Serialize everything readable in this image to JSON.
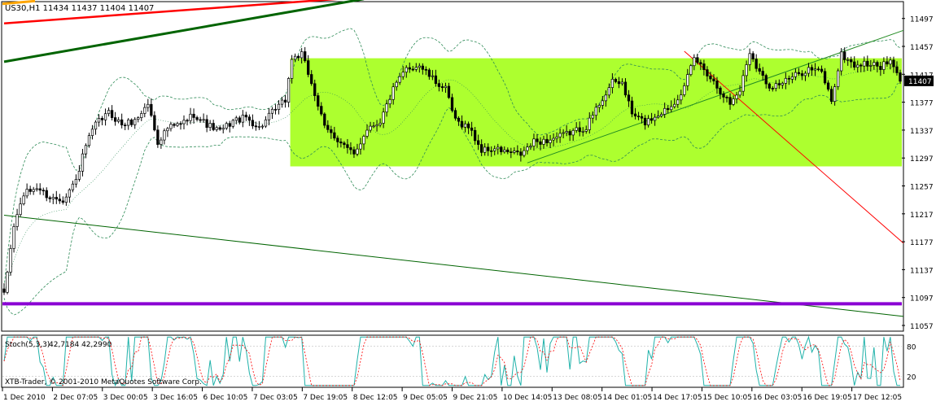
{
  "window": {
    "symbol_label": "US30,H1  11434 11437 11404 11407",
    "watermark": "XTB-Trader, © 2001-2010 MetaQuotes Software Corp."
  },
  "colors": {
    "bull_candle": "#000000",
    "bear_candle": "#000000",
    "range_box": "#adff2f",
    "bollinger": "#2e8b57",
    "trend_up": "#228b22",
    "trend_red": "#ff0000",
    "trend_down": "#006400",
    "support_purple": "#8a00d4",
    "stoch_main": "#20b2aa",
    "stoch_signal": "#ff0000",
    "price_tag_bg": "#000000",
    "price_tag_text": "#ffffff"
  },
  "chart_data": [
    {
      "type": "candlestick",
      "title": "US30,H1",
      "last_price": 11407,
      "ohlc_header": {
        "open": 11434,
        "high": 11437,
        "low": 11404,
        "close": 11407
      },
      "ylim": [
        11050,
        11520
      ],
      "y_ticks": [
        "11497",
        "11457",
        "11417",
        "11377",
        "11337",
        "11297",
        "11257",
        "11217",
        "11177",
        "11137",
        "11097",
        "11057"
      ],
      "x_ticks": [
        "1 Dec 2010",
        "2 Dec 07:05",
        "3 Dec 00:05",
        "3 Dec 16:05",
        "6 Dec 10:05",
        "7 Dec 03:05",
        "7 Dec 19:05",
        "8 Dec 12:05",
        "9 Dec 05:05",
        "9 Dec 21:05",
        "10 Dec 14:05",
        "13 Dec 08:05",
        "14 Dec 01:05",
        "14 Dec 17:05",
        "15 Dec 10:05",
        "16 Dec 03:05",
        "16 Dec 19:05",
        "17 Dec 12:05"
      ],
      "bar_count": 275,
      "anchors": [
        [
          0,
          11100
        ],
        [
          3,
          11200
        ],
        [
          6,
          11245
        ],
        [
          10,
          11255
        ],
        [
          14,
          11240
        ],
        [
          18,
          11238
        ],
        [
          22,
          11265
        ],
        [
          25,
          11315
        ],
        [
          28,
          11345
        ],
        [
          32,
          11362
        ],
        [
          36,
          11345
        ],
        [
          40,
          11350
        ],
        [
          44,
          11375
        ],
        [
          47,
          11320
        ],
        [
          50,
          11340
        ],
        [
          54,
          11345
        ],
        [
          58,
          11360
        ],
        [
          62,
          11345
        ],
        [
          66,
          11335
        ],
        [
          70,
          11350
        ],
        [
          74,
          11355
        ],
        [
          78,
          11340
        ],
        [
          82,
          11362
        ],
        [
          86,
          11380
        ],
        [
          88,
          11440
        ],
        [
          91,
          11445
        ],
        [
          94,
          11405
        ],
        [
          98,
          11340
        ],
        [
          103,
          11320
        ],
        [
          107,
          11300
        ],
        [
          111,
          11340
        ],
        [
          115,
          11350
        ],
        [
          119,
          11395
        ],
        [
          123,
          11425
        ],
        [
          127,
          11430
        ],
        [
          131,
          11410
        ],
        [
          135,
          11395
        ],
        [
          138,
          11350
        ],
        [
          142,
          11342
        ],
        [
          146,
          11308
        ],
        [
          150,
          11310
        ],
        [
          154,
          11305
        ],
        [
          158,
          11302
        ],
        [
          162,
          11320
        ],
        [
          166,
          11322
        ],
        [
          170,
          11328
        ],
        [
          174,
          11335
        ],
        [
          178,
          11342
        ],
        [
          182,
          11375
        ],
        [
          186,
          11405
        ],
        [
          189,
          11405
        ],
        [
          192,
          11360
        ],
        [
          196,
          11348
        ],
        [
          200,
          11360
        ],
        [
          204,
          11372
        ],
        [
          208,
          11398
        ],
        [
          211,
          11440
        ],
        [
          214,
          11425
        ],
        [
          218,
          11400
        ],
        [
          222,
          11375
        ],
        [
          225,
          11395
        ],
        [
          228,
          11450
        ],
        [
          231,
          11420
        ],
        [
          234,
          11400
        ],
        [
          238,
          11405
        ],
        [
          242,
          11415
        ],
        [
          246,
          11425
        ],
        [
          250,
          11420
        ],
        [
          253,
          11380
        ],
        [
          256,
          11445
        ],
        [
          260,
          11430
        ],
        [
          264,
          11432
        ],
        [
          268,
          11428
        ],
        [
          271,
          11435
        ],
        [
          274,
          11407
        ]
      ],
      "range_box": {
        "from_bar": 88,
        "to_bar": 274,
        "top": 11440,
        "bottom": 11285
      },
      "bollinger_width": 45,
      "trend_lines": [
        {
          "name": "up-channel",
          "from": [
            160,
            11290
          ],
          "to": [
            275,
            11480
          ]
        },
        {
          "name": "red-down",
          "from": [
            208,
            11450
          ],
          "to": [
            275,
            11175
          ]
        },
        {
          "name": "long-down",
          "from": [
            0,
            11215
          ],
          "to": [
            275,
            11070
          ]
        },
        {
          "name": "top-red",
          "from": [
            0,
            11490
          ],
          "to": [
            102,
            11525
          ]
        },
        {
          "name": "top-green",
          "from": [
            0,
            11435
          ],
          "to": [
            110,
            11525
          ]
        }
      ],
      "support_level": 11088
    },
    {
      "type": "line",
      "title": "Stoch(5,3,3)",
      "values_label": "42,7184 42,2990",
      "ylim": [
        0,
        100
      ],
      "y_ticks": [
        "80",
        "20"
      ],
      "series": [
        {
          "name": "main"
        },
        {
          "name": "signal"
        }
      ]
    }
  ]
}
